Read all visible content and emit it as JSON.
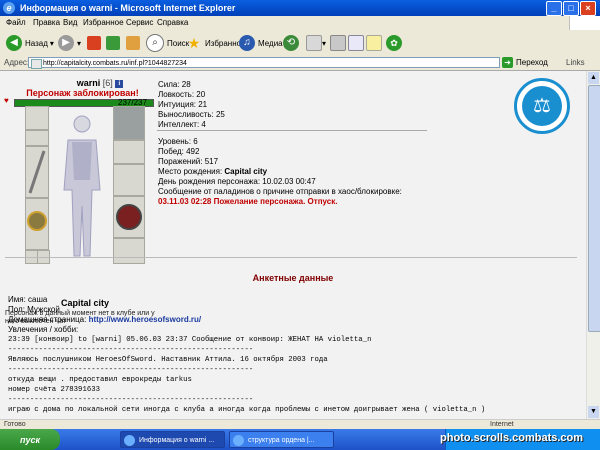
{
  "window": {
    "title": "Информация о warni - Microsoft Internet Explorer"
  },
  "menu": [
    "Файл",
    "Правка",
    "Вид",
    "Избранное",
    "Сервис",
    "Справка"
  ],
  "toolbar": {
    "back": "Назад",
    "search": "Поиск",
    "favorites": "Избранное",
    "media": "Медиа"
  },
  "address": {
    "label": "Адрес:",
    "url": "http://capitalcity.combats.ru/inf.pl?1044827234",
    "go": "Переход",
    "links": "Links"
  },
  "character": {
    "name": "warni",
    "level": "[6]",
    "blocked": "Персонаж заблокирован!",
    "hp": "237/237",
    "hp_fraction": 1.0,
    "city": "Capital city",
    "offline_note": "Персонаж в данный момент нет в клубе или у него выключен чат"
  },
  "stats": [
    "Сила: 28",
    "Ловкость: 20",
    "Интуиция: 21",
    "Выносливость: 25",
    "Интеллект: 4"
  ],
  "info": {
    "level": "Уровень: 6",
    "wins": "Побед: 492",
    "losses": "Поражений: 517",
    "birthplace_label": "Место рождения: ",
    "birthplace": "Capital city",
    "birthday": "День рождения персонажа: 10.02.03 00:47",
    "paladin_msg": "Сообщение от паладинов о причине отправки в хаос/блокировке:",
    "paladin_reason": "03.11.03 02:28 Пожелание персонажа. Отпуск."
  },
  "profile": {
    "section_title": "Анкетные данные",
    "name": "Имя: саша",
    "gender": "Пол: Мужской",
    "homepage_label": "Домашняя страница: ",
    "homepage": "http://www.heroesofsword.ru/",
    "hobby": "Увлечения / хобби:",
    "lines": [
      "23:39 [конвоир] to [warni] 05.06.03 23:37 Сообщение от конвоир: ЖЕНАТ НА violetta_n",
      "",
      "--------------------------------------------------------",
      "Являюсь послушником HeroesOfSword. Наставник Аттила. 16 октября 2003 года",
      "--------------------------------------------------------",
      "откуда  вещи .  предоставил  еврокреды  tarkus",
      "номер  счёта 278391633",
      "--------------------------------------------------------",
      "играю с дома по локальной сети иногда с клуба а иногда когда проблемы с инетом доигрывает жена ( violetta_n )"
    ]
  },
  "status": {
    "done": "Готово",
    "zone": "Internet"
  },
  "taskbar": {
    "start": "пуск",
    "tasks": [
      "Информация о warni ...",
      "структура ордена |..."
    ]
  },
  "watermark": "photo.scrolls.combats.com"
}
